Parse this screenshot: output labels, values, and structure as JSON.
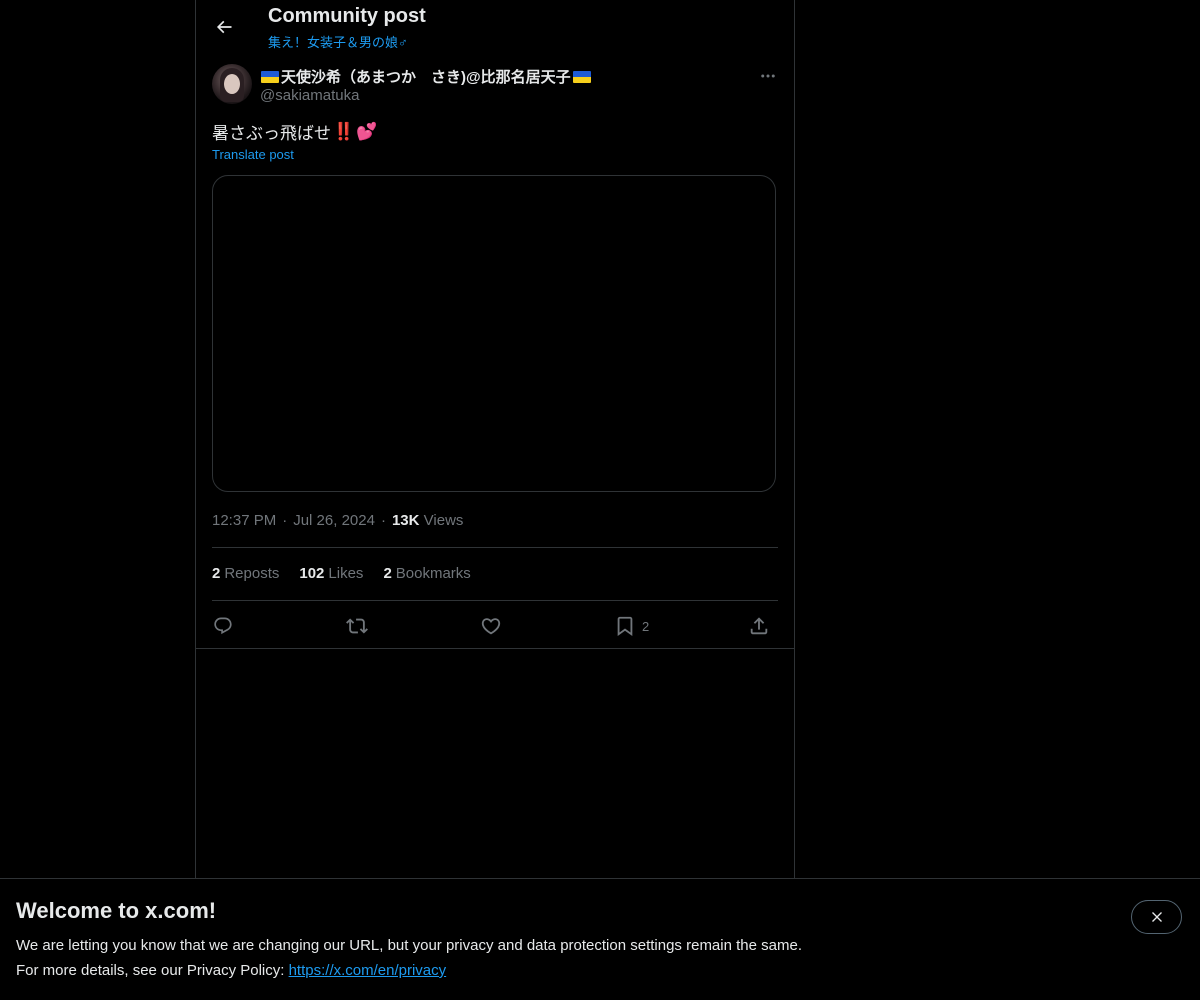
{
  "header": {
    "title": "Community post",
    "community_name": "集え！女装子＆男の娘♂"
  },
  "post": {
    "display_name": "天使沙希（あまつか　さき)@比那名居天子",
    "handle": "@sakiamatuka",
    "text": "暑さぶっ飛ばせ",
    "text_emoji_1": "‼️",
    "text_emoji_2": "💕",
    "translate_label": "Translate post",
    "time": "12:37 PM",
    "separator": "·",
    "date": "Jul 26, 2024",
    "views_count": "13K",
    "views_label": "Views"
  },
  "stats": {
    "reposts_count": "2",
    "reposts_label": "Reposts",
    "likes_count": "102",
    "likes_label": "Likes",
    "bookmarks_count": "2",
    "bookmarks_label": "Bookmarks"
  },
  "actions": {
    "bookmark_count": "2"
  },
  "banner": {
    "title": "Welcome to x.com!",
    "line1": "We are letting you know that we are changing our URL, but your privacy and data protection settings remain the same.",
    "line2_prefix": "For more details, see our Privacy Policy: ",
    "privacy_link": "https://x.com/en/privacy"
  },
  "colors": {
    "accent": "#1d9bf0",
    "background": "#000000",
    "border": "#2f3336",
    "muted_text": "#71767b"
  },
  "icons": [
    "back-arrow-icon",
    "more-icon",
    "reply-icon",
    "repost-icon",
    "like-icon",
    "bookmark-icon",
    "share-icon",
    "close-icon"
  ]
}
